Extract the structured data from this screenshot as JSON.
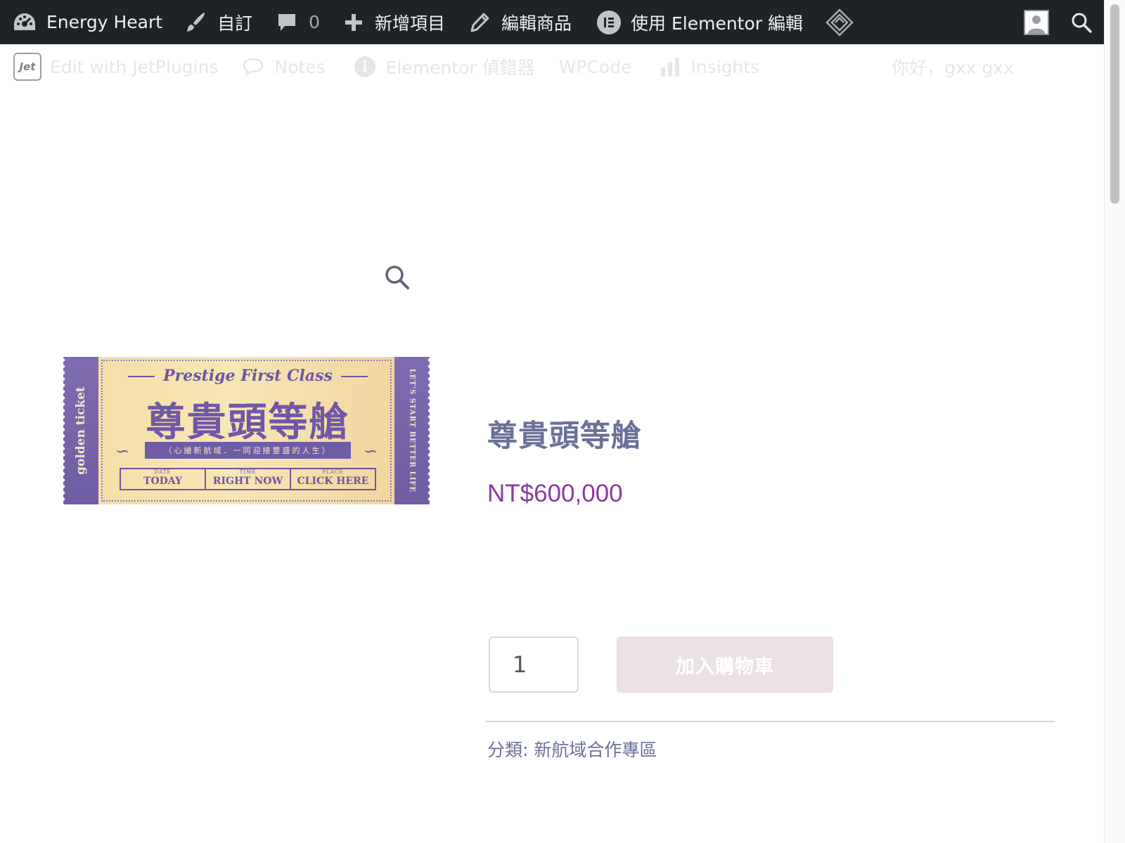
{
  "admin_bar": {
    "site_name": "Energy Heart",
    "customize_label": "自訂",
    "comments_count": "0",
    "new_label": "新增項目",
    "edit_product_label": "編輯商品",
    "elementor_label": "使用 Elementor 編輯"
  },
  "toolbar2": {
    "jet_logo": "Jet",
    "jet_label": "Edit with JetPlugins",
    "notes_label": "Notes",
    "debugger_label": "Elementor 偵錯器",
    "wpcode_label": "WPCode",
    "insights_label": "Insights",
    "greeting": "你好，gxx gxx"
  },
  "ticket": {
    "stub_left": "golden ticket",
    "stub_right": "LET'S START BETTER LIFE",
    "script_title": "Prestige First Class",
    "big_title": "尊貴頭等艙",
    "ribbon": "（心繪新航域．一同迎接豐盛的人生）",
    "boxes": [
      {
        "small": "DATE",
        "big": "TODAY"
      },
      {
        "small": "TIME",
        "big": "RIGHT NOW"
      },
      {
        "small": "PLACE",
        "big": "CLICK HERE"
      }
    ]
  },
  "product": {
    "title": "尊貴頭等艙",
    "price": "NT$600,000",
    "quantity": "1",
    "add_to_cart": "加入購物車",
    "category_label": "分類:",
    "category": "新航域合作專區"
  },
  "colors": {
    "admin_bar_bg": "#1d2327",
    "title": "#6b7196",
    "price": "#8a3aa3",
    "button_bg": "#ece2e6"
  }
}
